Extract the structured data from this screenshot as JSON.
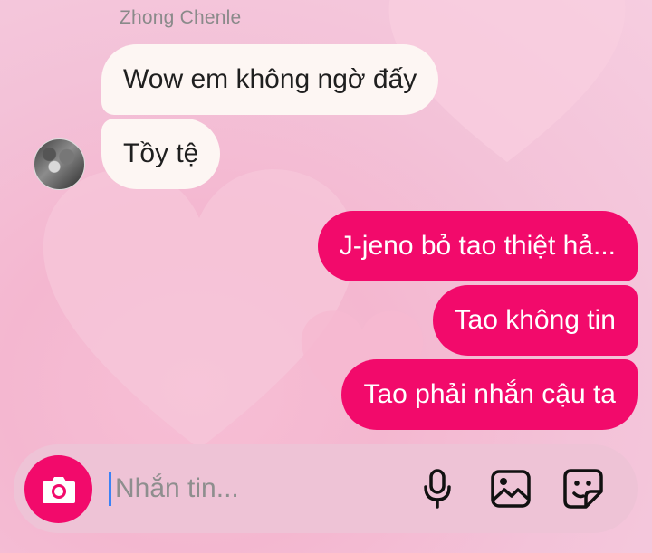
{
  "conversation": {
    "sender_name": "Zhong Chenle",
    "incoming": [
      {
        "text": "Wow em không ngờ đấy"
      },
      {
        "text": "Tồy tệ"
      }
    ],
    "outgoing": [
      {
        "text": "J-jeno bỏ tao thiệt hả..."
      },
      {
        "text": "Tao không tin"
      },
      {
        "text": "Tao phải nhắn cậu ta"
      }
    ]
  },
  "composer": {
    "placeholder": "Nhắn tin...",
    "icons": [
      "camera-icon",
      "microphone-icon",
      "image-icon",
      "sticker-icon"
    ]
  },
  "colors": {
    "accent": "#f20a6b",
    "incoming_bubble": "#fdf6f3",
    "background": "#f4bcd3"
  }
}
